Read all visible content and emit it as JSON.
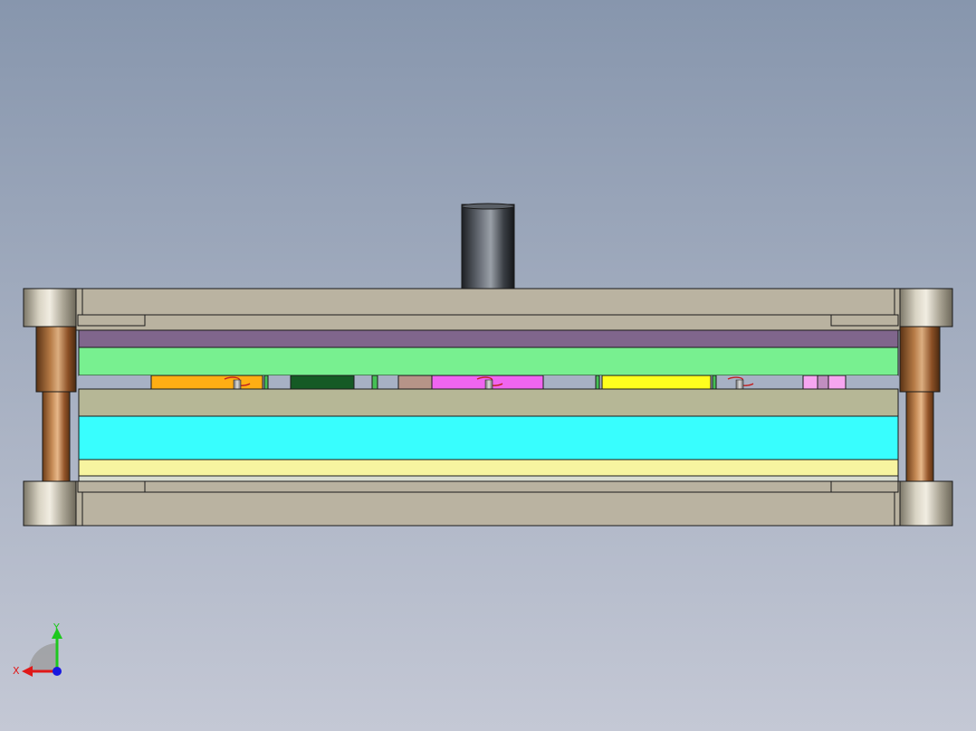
{
  "viewport": {
    "background_top": "#8796ad",
    "background_bottom": "#c4c8d5"
  },
  "triad": {
    "x_label": "X",
    "y_label": "Y",
    "x_color": "#e01818",
    "y_color": "#1ec81e",
    "z_color": "#1818e0"
  },
  "model": {
    "plate_gray": "#b9b2a0",
    "upper_purple": "#80668c",
    "upper_green": "#78f090",
    "middle_khaki": "#b6b796",
    "cyan_plate": "#38fefe",
    "yellow_plate": "#f7f4a0",
    "bushing_bronze": "#a0622e",
    "post_bronze": "#b87a44",
    "shank_dark": "#3a3e44",
    "inserts": [
      {
        "name": "orange-insert",
        "color": "#ffae14"
      },
      {
        "name": "dark-green-insert",
        "color": "#155a25"
      },
      {
        "name": "tan-insert",
        "color": "#b69488"
      },
      {
        "name": "magenta-insert",
        "color": "#f065f0"
      },
      {
        "name": "yellow-insert",
        "color": "#ffff1e"
      },
      {
        "name": "pink-insert",
        "color": "#f6a6f0"
      }
    ]
  }
}
